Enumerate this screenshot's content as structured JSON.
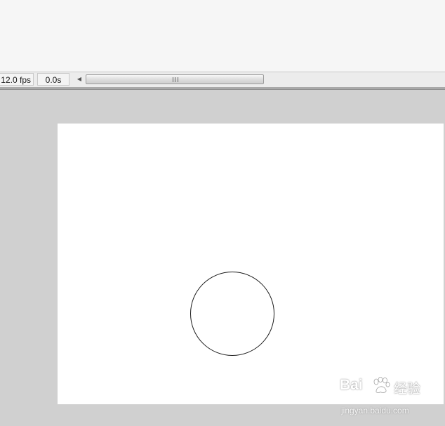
{
  "status_bar": {
    "frame_rate": "12.0 fps",
    "elapsed_time": "0.0s",
    "scroll_left_icon": "scroll-left-arrow",
    "scroll_thumb_icon": "grip-lines"
  },
  "stage": {
    "background_color": "#ffffff",
    "shape": {
      "type": "circle",
      "stroke_color": "#1a1a1a",
      "fill_color": "#ffffff"
    }
  },
  "watermark": {
    "logo_text": "Bai",
    "logo_suffix": "经验",
    "logo_icon": "baidu-paw",
    "url": "jingyan.baidu.com"
  },
  "colors": {
    "pasteboard": "#d0d0d0",
    "timeline_background": "#f6f6f6"
  }
}
